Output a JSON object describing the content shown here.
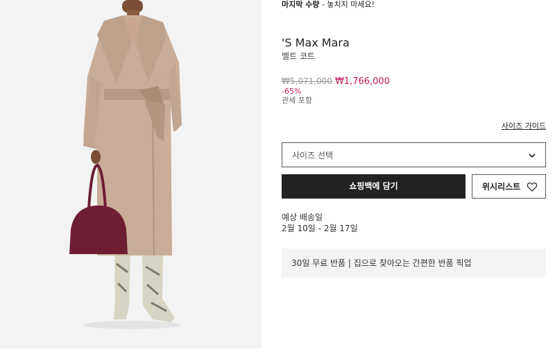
{
  "urgency": {
    "strong": "마지막 수량",
    "rest": " - 놓치지 마세요!"
  },
  "product": {
    "brand": "'S Max Mara",
    "name": "벨트 코트",
    "price_original": "₩5,071,000",
    "price_sale": "₩1,766,000",
    "discount": "-65%",
    "tax_note": "관세 포함"
  },
  "size": {
    "guide_label": "사이즈 가이드",
    "select_placeholder": "사이즈 선택"
  },
  "actions": {
    "add_to_bag": "쇼핑백에 담기",
    "wishlist": "위시리스트"
  },
  "delivery": {
    "label": "예상 배송일",
    "dates": "2월 10일 - 2월 17일"
  },
  "returns": {
    "text": "30일 무료 반품 | 집으로 찾아오는 간편한 반품 픽업"
  },
  "colors": {
    "sale": "#c2185b",
    "button_dark": "#222222",
    "panel_bg": "#f4f4f4",
    "coat": "#c9ad98",
    "bag": "#6e1e33"
  },
  "icons": [
    "chevron-down-icon",
    "heart-icon"
  ]
}
